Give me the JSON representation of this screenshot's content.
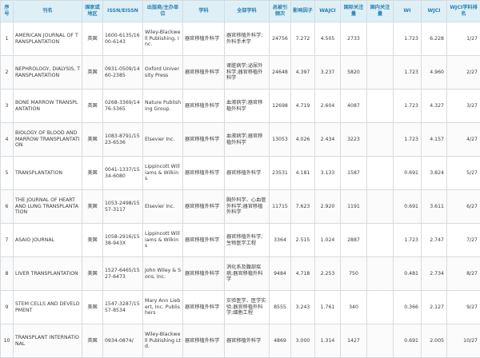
{
  "headers": [
    "序号",
    "刊名",
    "国家或地区",
    "ISSN/EISSN",
    "出版商/主办单位",
    "学科",
    "全部学科",
    "总被引频次",
    "影响因子",
    "WAJCI",
    "国际关注量",
    "国内关注量",
    "WI",
    "WJCI",
    "WJCI学科排名"
  ],
  "rows": [
    {
      "no": "1",
      "journal": "AMERICAN JOURNAL OF TRANSPLANTATION",
      "country": "英国",
      "issn": "1600-6135/1600-6143",
      "publisher": "Wiley-Blackwell Publishing, Inc.",
      "subject": "器官移植外科学",
      "all_subjects": "器官移植外科学;外科手术学",
      "citations": "24756",
      "impact_factor": "7.272",
      "wajci": "4.505",
      "intl_attention": "2733",
      "domestic_attention": "",
      "wi": "1.723",
      "wjci": "6.228",
      "rank": "1/27"
    },
    {
      "no": "2",
      "journal": "NEPHROLOGY, DIALYSIS, TRANSPLANTATION",
      "country": "英国",
      "issn": "0931-0509/1460-2385",
      "publisher": "Oxford University Press",
      "subject": "器官移植外科学",
      "all_subjects": "肾脏病学;泌尿外科学;器官移植外科学",
      "citations": "24648",
      "impact_factor": "4.397",
      "wajci": "3.237",
      "intl_attention": "5820",
      "domestic_attention": "",
      "wi": "1.723",
      "wjci": "4.960",
      "rank": "2/27"
    },
    {
      "no": "3",
      "journal": "BONE MARROW TRANSPLANTATION",
      "country": "英国",
      "issn": "0268-3369/1476-5365",
      "publisher": "Nature Publishing Group.",
      "subject": "器官移植外科学",
      "all_subjects": "血液病学;器官移植外科学",
      "citations": "12698",
      "impact_factor": "4.719",
      "wajci": "2.604",
      "intl_attention": "4087",
      "domestic_attention": "",
      "wi": "1.723",
      "wjci": "4.327",
      "rank": "3/27"
    },
    {
      "no": "4",
      "journal": "BIOLOGY OF BLOOD AND MARROW TRANSPLANTATION",
      "country": "美国",
      "issn": "1083-8791/1523-6536",
      "publisher": "Elsevier Inc.",
      "subject": "器官移植外科学",
      "all_subjects": "血液病学;器官移植外科学",
      "citations": "13053",
      "impact_factor": "4.026",
      "wajci": "2.434",
      "intl_attention": "3223",
      "domestic_attention": "",
      "wi": "1.723",
      "wjci": "4.157",
      "rank": "4/27"
    },
    {
      "no": "5",
      "journal": "TRANSPLANTATION",
      "country": "美国",
      "issn": "0041-1337/1534-6080",
      "publisher": "Lippincott Williams & Wilkins",
      "subject": "器官移植外科学",
      "all_subjects": "器官移植外科学",
      "citations": "23531",
      "impact_factor": "4.181",
      "wajci": "3.133",
      "intl_attention": "1587",
      "domestic_attention": "",
      "wi": "0.691",
      "wjci": "3.824",
      "rank": "5/27"
    },
    {
      "no": "6",
      "journal": "THE JOURNAL OF HEART AND LUNG TRANSPLANTATION",
      "country": "美国",
      "issn": "1053-2498/1557-3117",
      "publisher": "Elsevier Inc.",
      "subject": "器官移植外科学",
      "all_subjects": "胸外科学、心血管外科学;器官移植外科学",
      "citations": "11715",
      "impact_factor": "7.623",
      "wajci": "2.920",
      "intl_attention": "1191",
      "domestic_attention": "",
      "wi": "0.691",
      "wjci": "3.611",
      "rank": "6/27"
    },
    {
      "no": "7",
      "journal": "ASAIO JOURNAL",
      "country": "美国",
      "issn": "1058-2916/1538-943X",
      "publisher": "Lippincott Williams & Wilkins",
      "subject": "器官移植外科学",
      "all_subjects": "器官移植外科学;生物医学工程",
      "citations": "3364",
      "impact_factor": "2.515",
      "wajci": "1.024",
      "intl_attention": "2887",
      "domestic_attention": "",
      "wi": "1.723",
      "wjci": "2.747",
      "rank": "7/27"
    },
    {
      "no": "8",
      "journal": "LIVER TRANSPLANTATION",
      "country": "美国",
      "issn": "1527-6465/1527-6473",
      "publisher": "John Wiley & Sons, Inc.",
      "subject": "器官移植外科学",
      "all_subjects": "消化系及腹部疾病;器官移植外科学",
      "citations": "9484",
      "impact_factor": "4.718",
      "wajci": "2.253",
      "intl_attention": "750",
      "domestic_attention": "",
      "wi": "0.481",
      "wjci": "2.734",
      "rank": "8/27"
    },
    {
      "no": "9",
      "journal": "STEM CELLS AND DEVELOPMENT",
      "country": "美国",
      "issn": "1547-3287/1557-8534",
      "publisher": "Mary Ann Liebert, Inc. Publishers",
      "subject": "器官移植外科学",
      "all_subjects": "实验医学、医学实验;器官移植外科学;细胞工程",
      "citations": "8555",
      "impact_factor": "3.243",
      "wajci": "1.761",
      "intl_attention": "340",
      "domestic_attention": "",
      "wi": "0.366",
      "wjci": "2.127",
      "rank": "9/27"
    },
    {
      "no": "10",
      "journal": "TRANSPLANT INTERNATIONAL",
      "country": "英国",
      "issn": "0934-0874/",
      "publisher": "Wiley-Blackwell Publishing Ltd.",
      "subject": "器官移植外科学",
      "all_subjects": "器官移植外科学",
      "citations": "4869",
      "impact_factor": "3.000",
      "wajci": "1.314",
      "intl_attention": "1427",
      "domestic_attention": "",
      "wi": "0.691",
      "wjci": "2.005",
      "rank": "10/27"
    }
  ]
}
